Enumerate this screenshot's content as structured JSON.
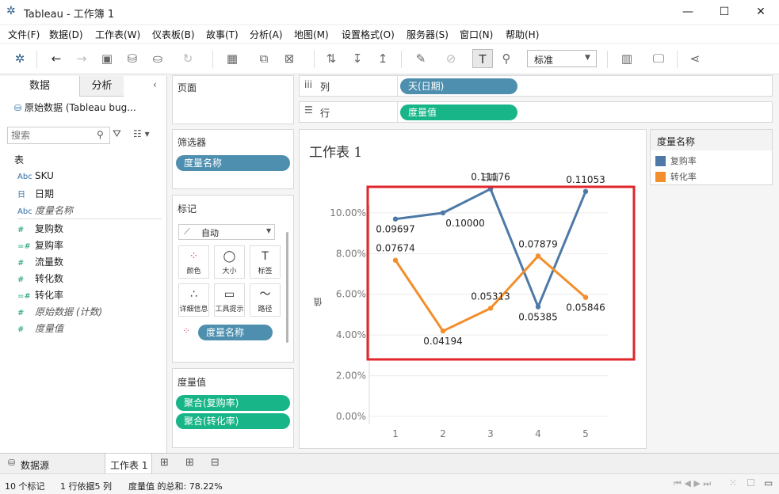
{
  "window": {
    "app_title": "Tableau - 工作簿 1",
    "minimize": "—",
    "maximize": "☐",
    "close": "✕"
  },
  "menu": [
    "文件(F)",
    "数据(D)",
    "工作表(W)",
    "仪表板(B)",
    "故事(T)",
    "分析(A)",
    "地图(M)",
    "设置格式(O)",
    "服务器(S)",
    "窗口(N)",
    "帮助(H)"
  ],
  "toolbar": {
    "fit_value": "标准"
  },
  "left_pane": {
    "tab_data": "数据",
    "tab_analysis": "分析",
    "datasource": "原始数据 (Tableau bug...",
    "search_placeholder": "搜索",
    "section_tables": "表",
    "dimensions": [
      {
        "icon": "Abc",
        "name": "SKU"
      },
      {
        "icon": "日",
        "name": "日期"
      },
      {
        "icon": "Abc",
        "name": "度量名称"
      }
    ],
    "measures": [
      {
        "icon": "#",
        "name": "复购数"
      },
      {
        "icon": "=#",
        "name": "复购率"
      },
      {
        "icon": "#",
        "name": "流量数"
      },
      {
        "icon": "#",
        "name": "转化数"
      },
      {
        "icon": "=#",
        "name": "转化率"
      },
      {
        "icon": "#",
        "name": "原始数据 (计数)"
      },
      {
        "icon": "#",
        "name": "度量值"
      }
    ]
  },
  "shelves": {
    "pages_label": "页面",
    "columns_label": "列",
    "columns_pill": "天(日期)",
    "rows_label": "行",
    "rows_pill": "度量值",
    "filters_label": "筛选器",
    "filters_pill": "度量名称",
    "marks_label": "标记",
    "marks_type": "自动",
    "mark_buttons": [
      {
        "label": "颜色",
        "glyph": "●"
      },
      {
        "label": "大小",
        "glyph": "◯"
      },
      {
        "label": "标签",
        "glyph": "T"
      },
      {
        "label": "详细信息",
        "glyph": "∴"
      },
      {
        "label": "工具提示",
        "glyph": "▭"
      },
      {
        "label": "路径",
        "glyph": "〜"
      }
    ],
    "marks_color_pill": "度量名称",
    "measure_values_label": "度量值",
    "measure_values_pills": [
      "聚合(复购率)",
      "聚合(转化率)"
    ]
  },
  "legend": {
    "title": "度量名称",
    "items": [
      {
        "name": "复购率",
        "color": "#4e79a7"
      },
      {
        "name": "转化率",
        "color": "#f28e2b"
      }
    ]
  },
  "sheet": {
    "title": "工作表 1",
    "header": "日期",
    "y_axis_label": "值"
  },
  "chart_data": {
    "type": "line",
    "title": "工作表 1",
    "xlabel": "日期",
    "ylabel": "值",
    "x": [
      1,
      2,
      3,
      4,
      5
    ],
    "y_ticks": [
      "0.00%",
      "2.00%",
      "4.00%",
      "6.00%",
      "8.00%",
      "10.00%"
    ],
    "ylim": [
      0,
      0.12
    ],
    "grid": true,
    "legend": "right",
    "series": [
      {
        "name": "复购率",
        "color": "#4e79a7",
        "values": [
          0.09697,
          0.1,
          0.11176,
          0.05385,
          0.11053
        ],
        "labels": [
          "0.09697",
          "0.10000",
          "0.11176",
          "0.05385",
          "0.11053"
        ]
      },
      {
        "name": "转化率",
        "color": "#f28e2b",
        "values": [
          0.07674,
          0.04194,
          0.05313,
          0.07879,
          0.05846
        ],
        "labels": [
          "0.07674",
          "0.04194",
          "0.05313",
          "0.07879",
          "0.05846"
        ]
      }
    ],
    "highlight_color": "#e0252b"
  },
  "bottom_tabs": {
    "datasource": "数据源",
    "sheet": "工作表 1"
  },
  "status": {
    "marks": "10 个标记",
    "rows_cols": "1 行依据5 列",
    "sum": "度量值 的总和: 78.22%"
  }
}
